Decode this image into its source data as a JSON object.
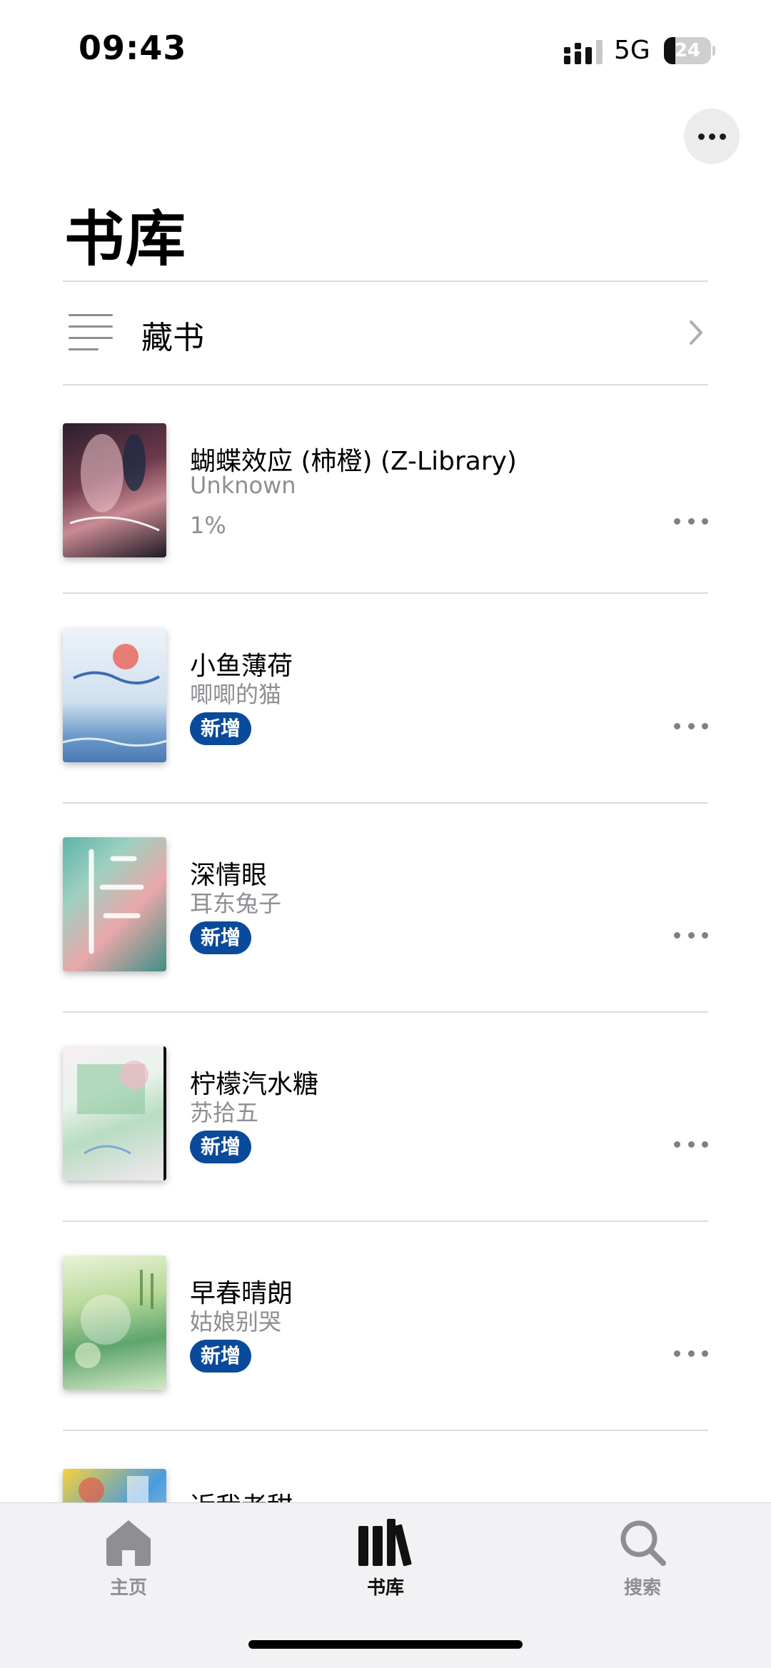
{
  "status": {
    "time": "09:43",
    "network": "5G",
    "battery": "24",
    "battery_level": 0.24
  },
  "header": {
    "title": "书库"
  },
  "collection": {
    "label": "藏书"
  },
  "books": [
    {
      "title": "蝴蝶效应 (柿橙) (Z-Library)",
      "author": "Unknown",
      "progress": "1%",
      "badge": ""
    },
    {
      "title": "小鱼薄荷",
      "author": "唧唧的猫",
      "progress": "",
      "badge": "新增"
    },
    {
      "title": "深情眼",
      "author": "耳东兔子",
      "progress": "",
      "badge": "新增"
    },
    {
      "title": "柠檬汽水糖",
      "author": "苏拾五",
      "progress": "",
      "badge": "新增"
    },
    {
      "title": "早春晴朗",
      "author": "姑娘别哭",
      "progress": "",
      "badge": "新增"
    },
    {
      "title": "近我者甜",
      "author": "",
      "progress": "",
      "badge": ""
    }
  ],
  "tabbar": {
    "items": [
      {
        "label": "主页",
        "icon": "home-icon",
        "active": false
      },
      {
        "label": "书库",
        "icon": "library-icon",
        "active": true
      },
      {
        "label": "搜索",
        "icon": "search-icon",
        "active": false
      }
    ]
  },
  "colors": {
    "badge": "#0a4a9a",
    "secondary_text": "#8e8e93",
    "tab_inactive": "#8e8e93",
    "tab_active": "#111111"
  }
}
